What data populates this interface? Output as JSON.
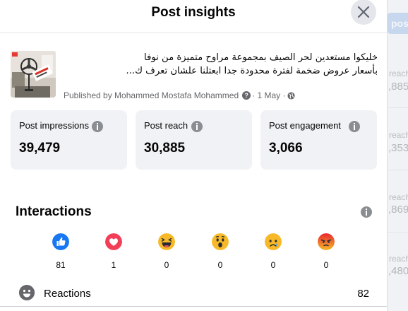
{
  "modal": {
    "title": "Post insights"
  },
  "post": {
    "text_line1": "خليكوا مستعدين لحر الصيف بمجموعة مراوح متميزة من نوفا",
    "text_line2": "بأسعار عروض ضخمة لفترة محدودة جدا ابعتلنا علشان تعرف ك...",
    "published_by": "Published by Mohammed Mostafa Mohammed",
    "date": "· 1 May ·",
    "privacy_icon": "globe-icon"
  },
  "stats": [
    {
      "label": "Post impressions",
      "value": "39,479"
    },
    {
      "label": "Post reach",
      "value": "30,885"
    },
    {
      "label": "Post engagement",
      "value": "3,066"
    }
  ],
  "interactions": {
    "title": "Interactions",
    "reactions": [
      {
        "name": "like",
        "count": "81"
      },
      {
        "name": "love",
        "count": "1"
      },
      {
        "name": "haha",
        "count": "0"
      },
      {
        "name": "wow",
        "count": "0"
      },
      {
        "name": "sad",
        "count": "0"
      },
      {
        "name": "angry",
        "count": "0"
      }
    ],
    "reactions_label": "Reactions",
    "reactions_total": "82"
  },
  "background": {
    "button_label": "post",
    "labels": [
      "reach",
      "reach",
      "reach",
      "reach"
    ],
    "values": [
      ",885",
      ",353",
      ",869",
      ",480"
    ]
  },
  "colors": {
    "like": "#1877f2",
    "love": "#f33e58",
    "emoji_yellow": "#f7b928",
    "angry": "#e9710f"
  }
}
